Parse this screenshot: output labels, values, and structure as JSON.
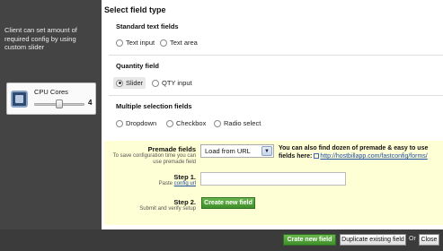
{
  "left": {
    "help_text": "Client can set amount of required config by using custom slider",
    "preview": {
      "title": "CPU Cores",
      "value": "4",
      "slider_level": 0.5
    }
  },
  "main": {
    "title": "Select field type",
    "sections": [
      {
        "title": "Standard text fields",
        "options": [
          "Text input",
          "Text area"
        ]
      },
      {
        "title": "Quantity field",
        "options": [
          "Slider",
          "QTY input"
        ],
        "selected": "Slider"
      },
      {
        "title": "Multiple selection fields",
        "options": [
          "Dropdown",
          "Checkbox",
          "Radio select"
        ]
      }
    ]
  },
  "premade": {
    "label": "Premade fields",
    "sublabel": "To save configuration time you can use premade field",
    "select_value": "Load from URL",
    "info_bold": "You can also find dozen of premade & easy to use fields here:",
    "info_link": "http://hostbillapp.com/fastconfig/forms/",
    "step1_label": "Step 1.",
    "step1_sub_prefix": "Paste",
    "step1_sub_link": "config url",
    "step1_input_value": "",
    "step2_label": "Step 2.",
    "step2_sub": "Submit and verify setup",
    "create_button": "Create new field"
  },
  "footer": {
    "create_button": "Crate new field",
    "duplicate_button": "Duplicate existing field",
    "or_text": "Or",
    "close_button": "Close"
  },
  "colors": {
    "left_panel": "#444444",
    "premade_bg": "#ffffd6",
    "green_button": "#4a9a34",
    "link": "#1f4ea0"
  }
}
